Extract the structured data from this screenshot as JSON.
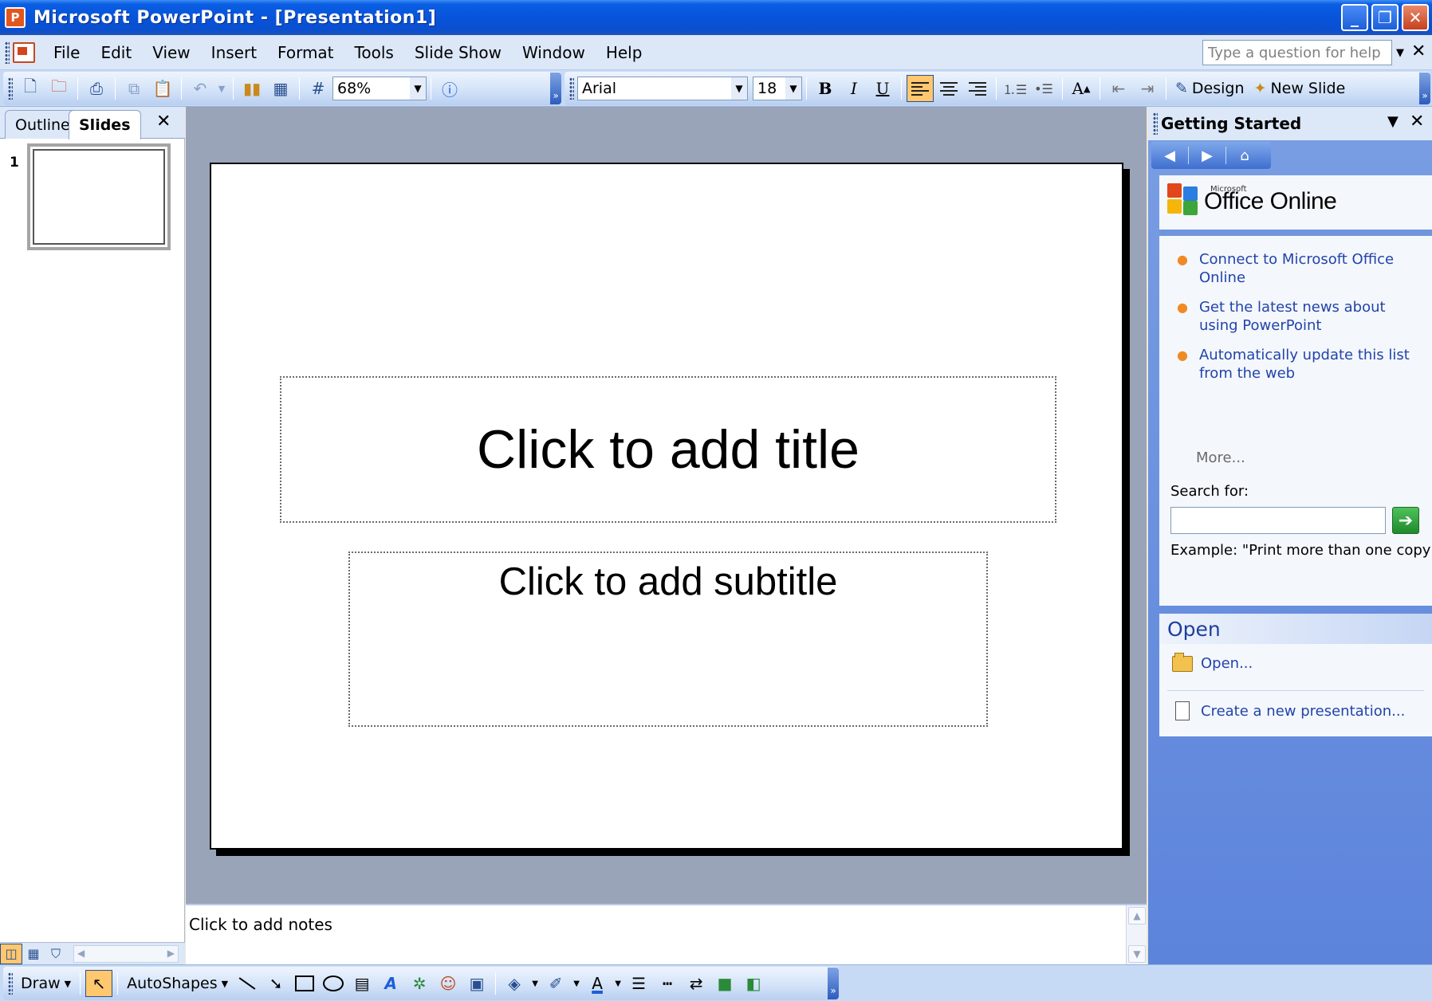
{
  "window": {
    "title": "Microsoft PowerPoint - [Presentation1]",
    "minimize": "_",
    "restore": "❐",
    "close": "✕"
  },
  "menu": {
    "items": [
      {
        "label": "File"
      },
      {
        "label": "Edit"
      },
      {
        "label": "View"
      },
      {
        "label": "Insert"
      },
      {
        "label": "Format"
      },
      {
        "label": "Tools"
      },
      {
        "label": "Slide Show"
      },
      {
        "label": "Window"
      },
      {
        "label": "Help"
      }
    ],
    "help_placeholder": "Type a question for help",
    "close": "✕"
  },
  "toolbar": {
    "zoom": "68%",
    "font": "Arial",
    "font_size": "18",
    "design_label": "Design",
    "new_slide_label": "New Slide"
  },
  "slides_pane": {
    "tab_outline": "Outline",
    "tab_slides": "Slides",
    "close": "✕",
    "slide_number": "1"
  },
  "slide": {
    "title_placeholder": "Click to add title",
    "subtitle_placeholder": "Click to add subtitle"
  },
  "notes": {
    "placeholder": "Click to add notes"
  },
  "task_pane": {
    "title": "Getting Started",
    "close": "✕",
    "logo_small": "Microsoft",
    "logo_text": "Office Online",
    "links": [
      {
        "label": "Connect to Microsoft Office Online"
      },
      {
        "label": "Get the latest news about using PowerPoint"
      },
      {
        "label": "Automatically update this list from the web"
      }
    ],
    "more": "More...",
    "search_label": "Search for:",
    "search_value": "",
    "example": "Example:  \"Print more than one copy\"",
    "open_heading": "Open",
    "open_item": "Open...",
    "create_item": "Create a new presentation..."
  },
  "drawing_toolbar": {
    "draw_label": "Draw",
    "autoshapes_label": "AutoShapes"
  },
  "colors": {
    "titlebar": "#0753d9",
    "toolbar": "#c7daf5",
    "taskpane": "#6f95df",
    "slide_area": "#9aa4b8",
    "link": "#2244aa",
    "accent_active": "#ffc76e"
  }
}
